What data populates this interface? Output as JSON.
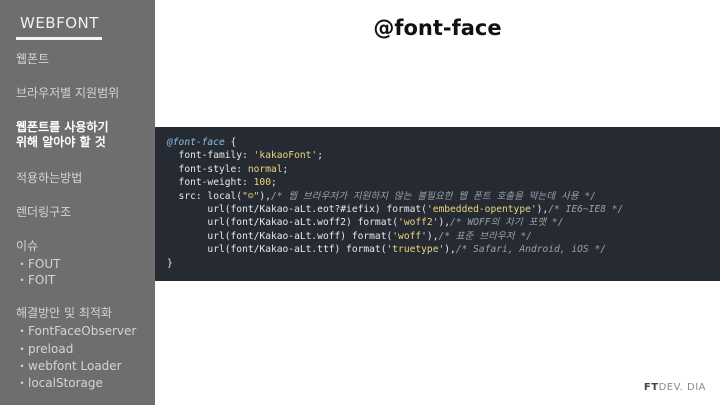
{
  "sidebar": {
    "brand": "WEBFONT",
    "items": [
      {
        "label": "웹폰트"
      },
      {
        "label": "브라우저별 지원범위"
      },
      {
        "label_line1": "웹폰트를 사용하기",
        "label_line2": "위해 알아야 할 것"
      },
      {
        "label": "적용하는방법"
      },
      {
        "label": "렌더링구조"
      },
      {
        "label": "이슈",
        "subs": [
          "・FOUT",
          "・FOIT"
        ]
      },
      {
        "label": "해결방안 및 최적화",
        "subs": [
          "・FontFaceObserver",
          "・preload",
          "・webfont Loader",
          "・localStorage"
        ]
      }
    ]
  },
  "main": {
    "title": "@font-face"
  },
  "code": {
    "at_rule": "@font-face",
    "brace_open": " {",
    "ff_prop": "  font-family: ",
    "ff_val": "'kakaoFont'",
    "fs_prop": "  font-style: ",
    "fs_val": "normal",
    "fw_prop": "  font-weight: ",
    "fw_val": "100",
    "src_prop": "  src: local(",
    "src_local": "\"☺\"",
    "src_close": "),",
    "src_comment": "/* 웹 브라우저가 지원하지 않는 불필요한 웹 폰트 호출을 막는데 사용 */",
    "url1": "       url(font/Kakao-aLt.eot?#iefix) format(",
    "fmt1": "'embedded-opentype'",
    "c1": "/* IE6~IE8 */",
    "url2": "       url(font/Kakao-aLt.woff2) format(",
    "fmt2": "'woff2'",
    "c2": "/* WOFF의 차기 포맷 */",
    "url3": "       url(font/Kakao-aLt.woff) format(",
    "fmt3": "'woff'",
    "c3": "/* 표준 브라우저 */",
    "url4": "       url(font/Kakao-aLt.ttf) format(",
    "fmt4": "'truetype'",
    "c4": "/* Safari, Android, iOS */",
    "close_paren": "),",
    "brace_close": "}"
  },
  "footer": {
    "brand_bold": "FT",
    "brand_rest": "DEV. DIA"
  },
  "colors": {
    "sidebar_bg": "#6e6e6e",
    "code_bg": "#262b33"
  }
}
